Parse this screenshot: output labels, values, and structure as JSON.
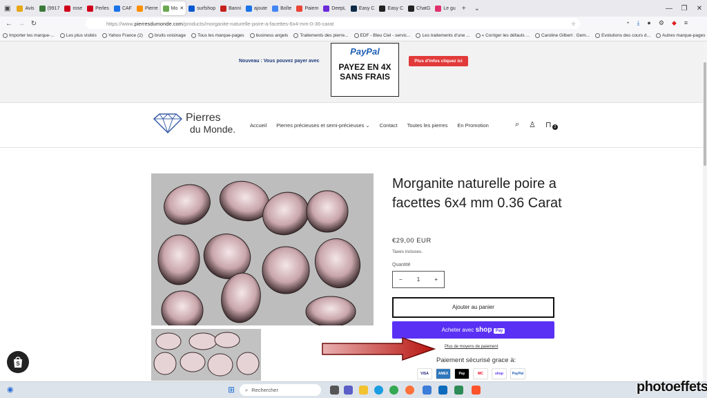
{
  "browser": {
    "tabs": [
      {
        "label": "Avis"
      },
      {
        "label": "(9917"
      },
      {
        "label": "rose"
      },
      {
        "label": "Perles"
      },
      {
        "label": "CAF"
      },
      {
        "label": "Pierre"
      },
      {
        "label": "Mo",
        "active": true
      },
      {
        "label": "surfshop"
      },
      {
        "label": "Banni"
      },
      {
        "label": "ajoute"
      },
      {
        "label": "Boîte"
      },
      {
        "label": "Paiem"
      },
      {
        "label": "DeepL"
      },
      {
        "label": "Easy C"
      },
      {
        "label": "Easy C"
      },
      {
        "label": "ChatG"
      },
      {
        "label": "Le gu"
      }
    ],
    "url_prefix": "https://www.",
    "url_host": "pierresdumonde.com",
    "url_path": "/products/morganite-naturelle-poire-a-facettes-6x4-mm-0-36-carat",
    "bookmarks": [
      "Importer les marque-...",
      "Les plus visités",
      "Yahoo France (2)",
      "bruits voisinage",
      "Tous les marque-pages",
      "business angels",
      "Traitements des pierre...",
      "EDF - Bleu Ciel - servic...",
      "Les traitements d'une ...",
      "« Corriger les défauts ...",
      "Caroline Gilbert : Gem...",
      "Evolutions des cours d...",
      "Autres marque-pages"
    ]
  },
  "banner": {
    "message": "Nouveau : Vous pouvez payer avec",
    "paypal_logo": "PayPal",
    "paypal_line1": "PAYEZ EN 4X",
    "paypal_line2": "SANS FRAIS",
    "info_button": "Plus d'infos cliquez ici"
  },
  "header": {
    "logo_line1": "Pierres",
    "logo_line2": "du Monde.",
    "menu": [
      {
        "label": "Accueil"
      },
      {
        "label": "Pierres précieuses et semi-précieuses",
        "dropdown": true
      },
      {
        "label": "Contact"
      },
      {
        "label": "Toutes les pierres"
      },
      {
        "label": "En Promotion"
      }
    ],
    "cart_count": "2"
  },
  "product": {
    "title": "Morganite naturelle poire a facettes 6x4 mm 0.36 Carat",
    "price": "€29,00 EUR",
    "tax_note": "Taxes incluses.",
    "quantity_label": "Quantité",
    "quantity_value": "1",
    "add_to_cart": "Ajouter au panier",
    "shoppay_prefix": "Acheter avec",
    "shoppay_brand": "shop",
    "shoppay_pay": "Pay",
    "more_payment": "Plus de moyens de paiement",
    "secure_text": "Paiement sécurisé grace à:",
    "payment_icons": [
      "VISA",
      "AMEX",
      "Pay",
      "MC",
      "shop",
      "PayPal"
    ]
  },
  "taskbar": {
    "search_placeholder": "Rechercher"
  },
  "watermark": "photoeffets",
  "colors": {
    "shoppay": "#5a31f4",
    "info_button": "#e23a3a",
    "arrow": "#c0201d",
    "accent_blue": "#1e5fb3"
  }
}
